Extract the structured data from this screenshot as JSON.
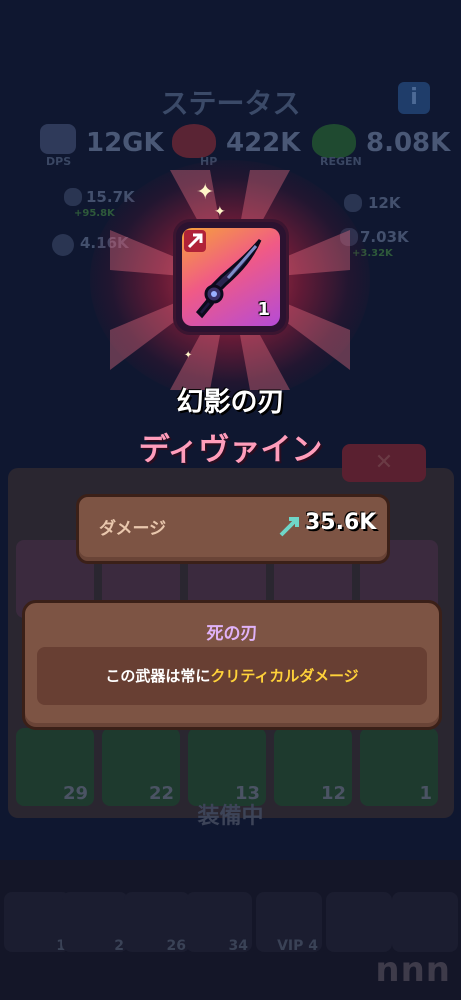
{
  "background": {
    "title": "ステータス",
    "info_label": "i",
    "stats": {
      "dps_value": "12GK",
      "dps_label": "DPS",
      "hp_value": "422K",
      "hp_label": "HP",
      "regen_value": "8.08K",
      "regen_label": "REGEN",
      "sub1": "15.7K",
      "sub1_bonus": "+95.8K",
      "sub2": "12K",
      "sub3": "4.16K",
      "sub4": "7.03K",
      "sub4_bonus": "+3.32K"
    },
    "inventory_counts": [
      "29",
      "22",
      "13",
      "12",
      "1"
    ],
    "equipped_label": "装備中",
    "bottom_slots": [
      "1",
      "2",
      "26",
      "34",
      "VIP 4",
      "",
      "",
      ""
    ],
    "watermark": "nnn"
  },
  "popup": {
    "item_count": "1",
    "item_name": "幻影の刃",
    "rarity": "ディヴァイン",
    "damage_label": "ダメージ",
    "damage_value": "35.6K",
    "skill_title": "死の刃",
    "skill_desc_prefix": "この武器は常に",
    "skill_desc_highlight": "クリティカルダメージ"
  },
  "colors": {
    "background": "#0f1730",
    "rarity": "#ff9dbb",
    "panel": "#7d5444",
    "skill_title": "#e0b2f8",
    "highlight": "#ffd23a"
  },
  "icons": [
    "info-icon",
    "dps-icon",
    "heart-icon",
    "regen-icon",
    "arrow-icon",
    "shield-icon",
    "sword-icon",
    "close-icon",
    "sparkle-icon",
    "blade-icon"
  ]
}
